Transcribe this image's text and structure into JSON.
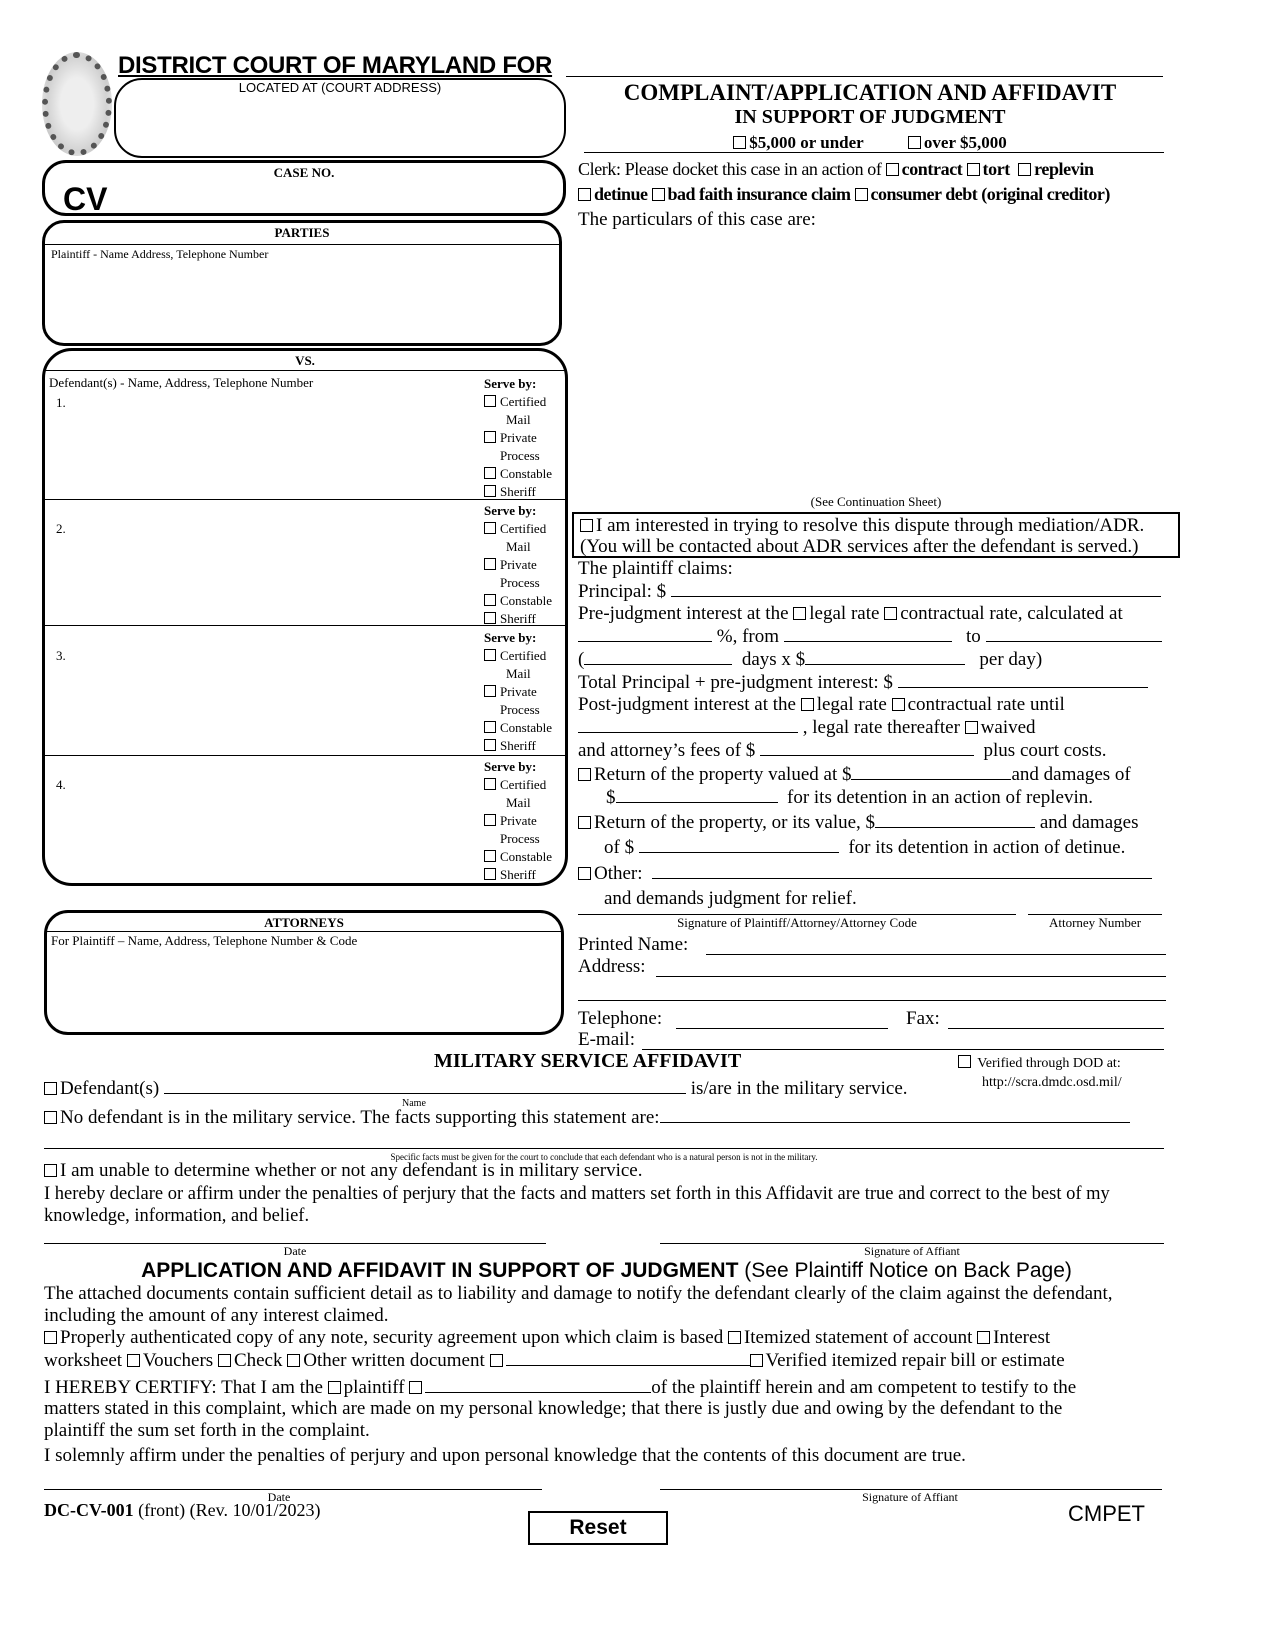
{
  "header": {
    "court_title": "DISTRICT COURT OF MARYLAND FOR",
    "located_at_label": "LOCATED AT (COURT ADDRESS)",
    "case_no_label": "CASE NO.",
    "case_prefix": "CV",
    "form_title_1": "COMPLAINT/APPLICATION AND AFFIDAVIT",
    "form_title_2": "IN SUPPORT OF JUDGMENT",
    "amount_options": [
      "$5,000 or under",
      "over $5,000"
    ]
  },
  "clerk": {
    "intro": "Clerk: Please docket this case in an action of",
    "actions": [
      "contract",
      "tort",
      "replevin",
      "detinue",
      "bad faith insurance claim",
      "consumer debt (original creditor)"
    ],
    "particulars_label": "The particulars of this case are:",
    "continuation_note": "(See Continuation Sheet)"
  },
  "parties": {
    "heading": "PARTIES",
    "plaintiff_label": "Plaintiff - Name Address, Telephone Number",
    "vs_label": "VS.",
    "defendant_label": "Defendant(s) - Name, Address, Telephone Number",
    "serve_by_label": "Serve by:",
    "serve_options": [
      "Certified",
      "Mail",
      "Private",
      "Process",
      "Constable",
      "Sheriff"
    ],
    "defendants": [
      {
        "number": "1."
      },
      {
        "number": "2."
      },
      {
        "number": "3."
      },
      {
        "number": "4."
      }
    ]
  },
  "attorneys": {
    "heading": "ATTORNEYS",
    "for_plaintiff_label": "For Plaintiff – Name, Address, Telephone Number & Code"
  },
  "adr": {
    "line1": "I am interested in trying to resolve this dispute through mediation/ADR.",
    "line2": "(You will be contacted about ADR services after the defendant is served.)"
  },
  "claims": {
    "intro": "The plaintiff claims:",
    "principal": "Principal: $",
    "prejudgment": "Pre-judgment interest at the",
    "legal_rate": "legal rate",
    "contractual_rate_calc": "contractual rate, calculated at",
    "pct_from": "%, from",
    "to": "to",
    "open_paren": "(",
    "days_x": "days x $",
    "per_day": "per day)",
    "total": "Total Principal + pre-judgment interest: $",
    "postjudgment": "Post-judgment interest at the",
    "contractual_rate_until": "contractual rate until",
    "legal_rate_thereafter": ", legal rate thereafter",
    "waived": "waived",
    "attorney_fees": "and attorney’s fees of $",
    "plus_costs": "plus court costs.",
    "replevin_1": "Return of the property valued at $",
    "replevin_1b": "and damages of",
    "replevin_2a": "$",
    "replevin_2b": "for its detention in an action of replevin.",
    "detinue_1": "Return of the property, or its value, $",
    "detinue_1b": "and damages",
    "detinue_2a": "of $",
    "detinue_2b": "for its detention in action of detinue.",
    "other": "Other:",
    "demands": "and demands judgment for relief."
  },
  "signature_block": {
    "signature_label": "Signature of Plaintiff/Attorney/Attorney Code",
    "attorney_number_label": "Attorney Number",
    "printed_name": "Printed Name:",
    "address": "Address:",
    "telephone": "Telephone:",
    "fax": "Fax:",
    "email": "E-mail:"
  },
  "military": {
    "heading": "MILITARY SERVICE AFFIDAVIT",
    "dod_label": "Verified through DOD at:",
    "dod_url": "http://scra.dmdc.osd.mil/",
    "defendants_label": "Defendant(s)",
    "name_caption": "Name",
    "in_service": "is/are in the military service.",
    "no_defendant": "No defendant is in the military service. The facts supporting this statement are:",
    "facts_note": "Specific facts must be given for the court to conclude that each defendant who is a natural person is not in the military.",
    "unable": "I am unable to determine whether or not any defendant is in military service.",
    "declare": "I hereby declare or affirm under the penalties of perjury that the facts and matters set forth in this Affidavit are true and correct to the best of my knowledge, information, and belief.",
    "date_label": "Date",
    "signature_label": "Signature of Affiant"
  },
  "application": {
    "heading_bold": "APPLICATION AND AFFIDAVIT IN SUPPORT OF JUDGMENT",
    "heading_note": "(See Plaintiff Notice on Back Page)",
    "intro": "The attached documents contain sufficient detail as to liability and damage to notify the defendant clearly of the claim against the defendant, including the amount of any interest claimed.",
    "doc_note": "Properly authenticated copy of any note, security agreement upon which claim is based",
    "itemized": "Itemized statement of account",
    "interest": "Interest",
    "worksheet": "worksheet",
    "vouchers": "Vouchers",
    "check": "Check",
    "other_doc": "Other written document",
    "repair_bill": "Verified itemized repair bill or estimate",
    "certify_a": "I HEREBY CERTIFY: That I am the",
    "plaintiff": "plaintiff",
    "certify_b": "of the plaintiff herein and am competent to testify to the",
    "certify_c": "matters stated in this complaint, which are made on my personal knowledge; that there is justly due and owing by the defendant to the",
    "certify_d": "plaintiff the sum set forth in the complaint.",
    "affirm": "I solemnly affirm under the penalties of perjury and upon personal knowledge that the contents of this document are true.",
    "date_label": "Date",
    "signature_label": "Signature of Affiant"
  },
  "footer": {
    "form_id": "DC-CV-001",
    "form_rev": "(front) (Rev. 10/01/2023)",
    "reset_label": "Reset",
    "code": "CMPET"
  }
}
